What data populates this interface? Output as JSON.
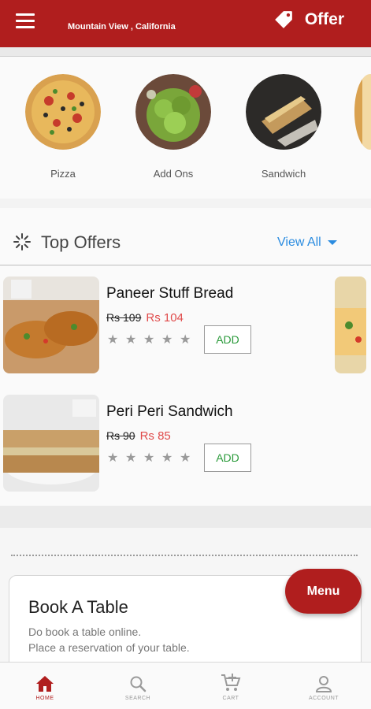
{
  "header": {
    "location": "Mountain View , California",
    "offer_label": "Offer"
  },
  "categories": [
    {
      "label": "Pizza"
    },
    {
      "label": "Add Ons"
    },
    {
      "label": "Sandwich"
    }
  ],
  "top_offers": {
    "title": "Top Offers",
    "view_all": "View All",
    "items": [
      {
        "name": "Paneer Stuff Bread",
        "old_price": "Rs 109",
        "new_price": "Rs 104",
        "rating": 0,
        "add_label": "ADD"
      },
      {
        "name": "Peri Peri Sandwich",
        "old_price": "Rs 90",
        "new_price": "Rs 85",
        "rating": 0,
        "add_label": "ADD"
      }
    ]
  },
  "book_table": {
    "title": "Book A Table",
    "line1": "Do book a table online.",
    "line2": "Place a reservation of your table."
  },
  "fab": {
    "label": "Menu"
  },
  "bottom_nav": {
    "items": [
      {
        "label": "HOME",
        "icon": "home-icon",
        "active": true
      },
      {
        "label": "SEARCH",
        "icon": "search-icon",
        "active": false
      },
      {
        "label": "CART",
        "icon": "cart-icon",
        "active": false
      },
      {
        "label": "ACCOUNT",
        "icon": "account-icon",
        "active": false
      }
    ]
  },
  "colors": {
    "brand": "#b01e1e",
    "link": "#2b8ce0",
    "price_new": "#e04a4a",
    "add_text": "#2a9a3a"
  }
}
